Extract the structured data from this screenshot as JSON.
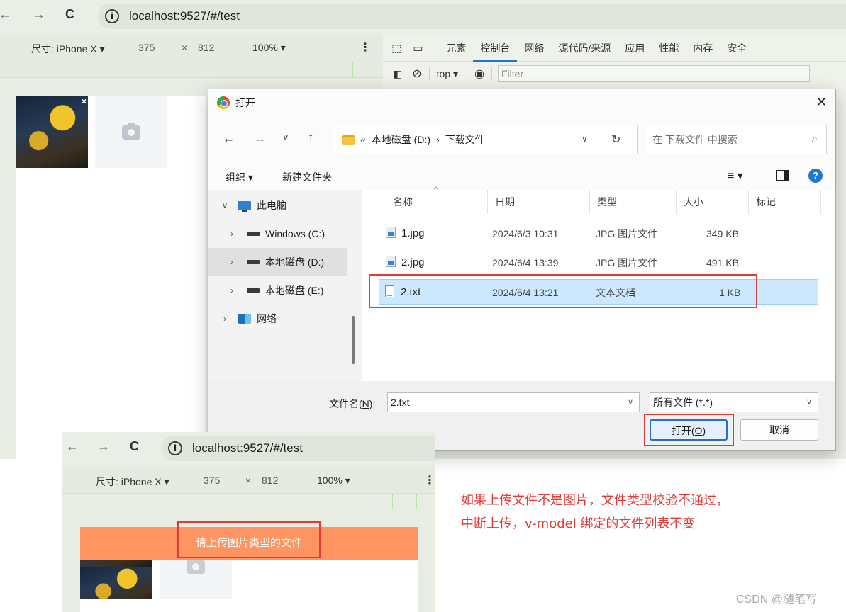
{
  "top_browser": {
    "url": "localhost:9527/#/test",
    "device_label": "尺寸: iPhone X",
    "width": "375",
    "times": "×",
    "height": "812",
    "zoom": "100%"
  },
  "devtools": {
    "tabs": [
      "元素",
      "控制台",
      "网络",
      "源代码/来源",
      "应用",
      "性能",
      "内存",
      "安全"
    ],
    "active_tab": "控制台",
    "context": "top",
    "filter_placeholder": "Filter"
  },
  "dialog": {
    "title": "打开",
    "breadcrumb": {
      "prefix": "«",
      "parent": "本地磁盘 (D:)",
      "separator": "›",
      "current": "下载文件"
    },
    "search_placeholder": "在 下载文件 中搜索",
    "organize_label": "组织 ▾",
    "new_folder_label": "新建文件夹",
    "tree": [
      {
        "label": "此电脑",
        "expanded": true,
        "icon": "pc-icon"
      },
      {
        "label": "Windows  (C:)",
        "icon": "drive-icon"
      },
      {
        "label": "本地磁盘 (D:)",
        "icon": "drive-icon",
        "selected": true
      },
      {
        "label": "本地磁盘 (E:)",
        "icon": "drive-icon"
      },
      {
        "label": "网络",
        "icon": "network-icon"
      }
    ],
    "columns": {
      "name": "名称",
      "date": "日期",
      "type": "类型",
      "size": "大小",
      "tag": "标记"
    },
    "files": [
      {
        "name": "1.jpg",
        "date": "2024/6/3 10:31",
        "type": "JPG 图片文件",
        "size": "349 KB",
        "icon": "image-file-icon"
      },
      {
        "name": "2.jpg",
        "date": "2024/6/4 13:39",
        "type": "JPG 图片文件",
        "size": "491 KB",
        "icon": "image-file-icon"
      },
      {
        "name": "2.txt",
        "date": "2024/6/4 13:21",
        "type": "文本文档",
        "size": "1 KB",
        "icon": "text-file-icon",
        "selected": true
      }
    ],
    "filename_label_pre": "文件名(",
    "filename_label_key": "N",
    "filename_label_post": "):",
    "filename_value": "2.txt",
    "filetype_value": "所有文件 (*.*)",
    "open_btn_pre": "打开(",
    "open_btn_key": "O",
    "open_btn_post": ")",
    "cancel_label": "取消"
  },
  "bottom_browser": {
    "url": "localhost:9527/#/test",
    "device_label": "尺寸: iPhone X",
    "width": "375",
    "times": "×",
    "height": "812",
    "zoom": "100%",
    "toast_message": "请上传图片类型的文件"
  },
  "annotation": {
    "line1": "如果上传文件不是图片，文件类型校验不通过，",
    "line2": "中断上传，v-model 绑定的文件列表不变"
  },
  "watermark": "CSDN @随笔写",
  "colors": {
    "highlight_red": "#e53935",
    "toast_bg": "#ff9463",
    "selection_blue": "#cce8ff"
  }
}
